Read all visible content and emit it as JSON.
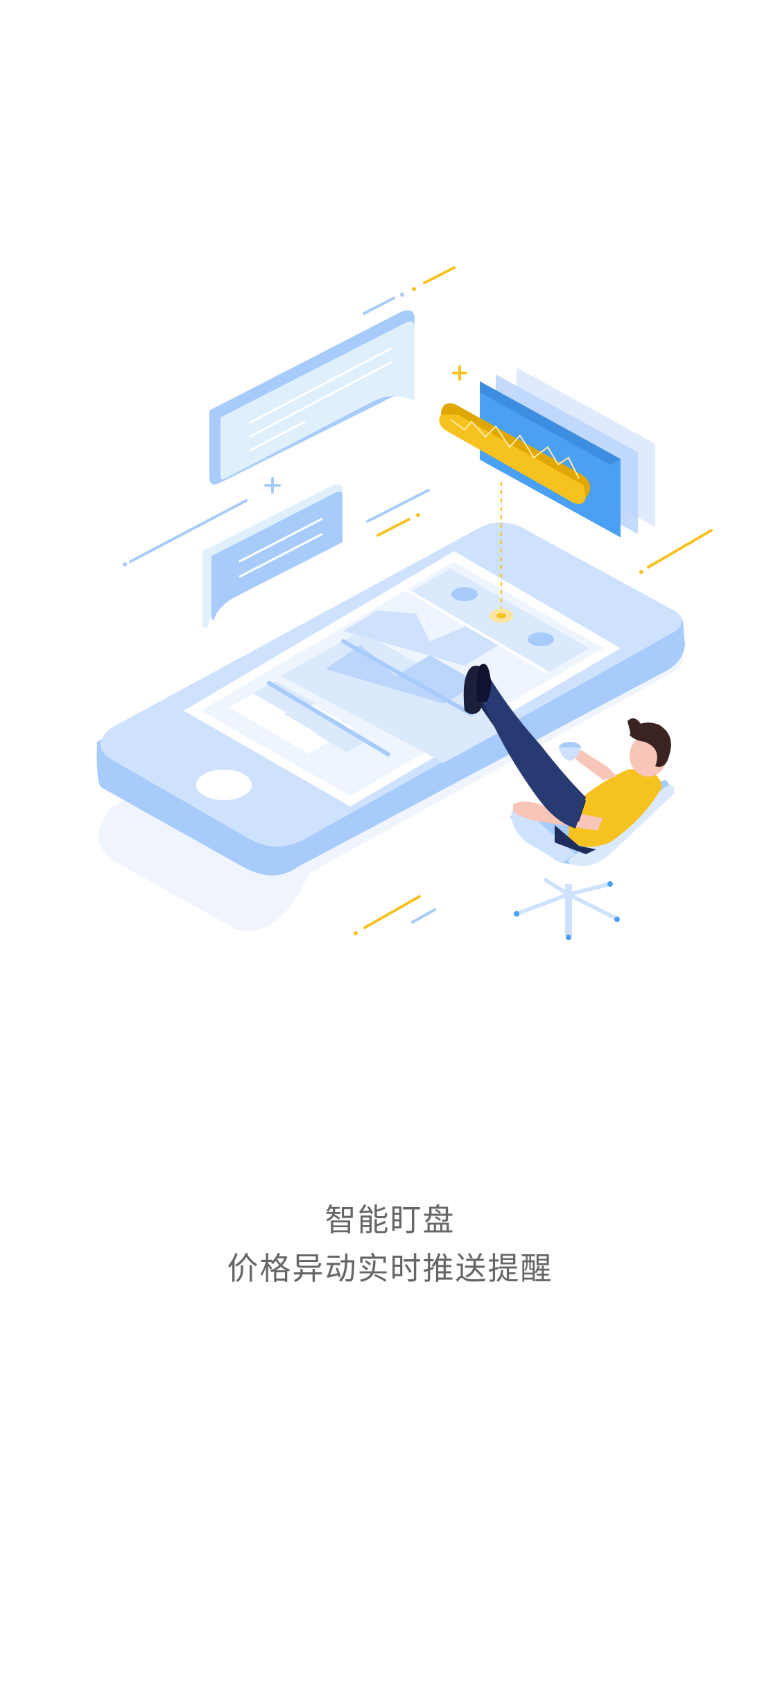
{
  "onboarding": {
    "title": "智能盯盘",
    "subtitle": "价格异动实时推送提醒"
  },
  "colors": {
    "background": "#ffffff",
    "text": "#666666",
    "primary_light": "#cfe2fd",
    "primary": "#a7cbfb",
    "primary_dark": "#4aa0f2",
    "accent_yellow": "#f5c220",
    "navy": "#1f2d5c"
  },
  "illustration": {
    "icons": [
      "phone-illustration",
      "chat-bubble-icon",
      "price-chart-cards-icon",
      "person-in-chair-illustration"
    ]
  }
}
